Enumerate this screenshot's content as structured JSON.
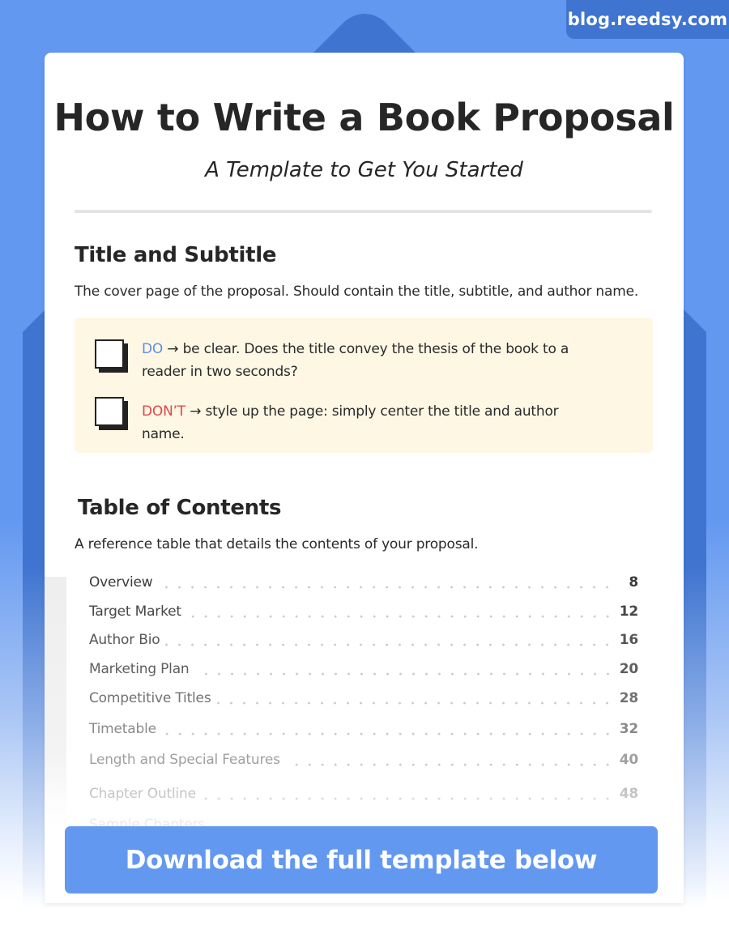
{
  "site_badge": "blog.reedsy.com",
  "colors": {
    "background_blue": "#6298f0",
    "dark_blue": "#3f74d0",
    "do_color": "#5b8fe6",
    "dont_color": "#e0454a",
    "tip_background": "#fdf7e4",
    "cta_background": "#6298f0"
  },
  "document": {
    "title": "How to Write a Book Proposal",
    "subtitle": "A Template to Get You Started"
  },
  "sections": [
    {
      "heading": "Title and Subtitle",
      "description": "The cover page of the proposal. Should contain the title, subtitle, and author name.",
      "tips": [
        {
          "keyword": "DO",
          "arrow": "→",
          "text": "be clear. Does the title convey the thesis of the book to a reader in two seconds?"
        },
        {
          "keyword": "DON’T",
          "arrow": "→",
          "text": "style up the page: simply center the title and author name."
        }
      ]
    },
    {
      "heading": "Table of Contents",
      "description": "A reference table that details the contents of your proposal.",
      "toc": [
        {
          "label": "Overview",
          "page": "8"
        },
        {
          "label": "Target Market",
          "page": "12"
        },
        {
          "label": "Author Bio",
          "page": "16"
        },
        {
          "label": "Marketing Plan",
          "page": "20"
        },
        {
          "label": "Competitive Titles",
          "page": "28"
        },
        {
          "label": "Timetable",
          "page": "32"
        },
        {
          "label": "Length and Special Features",
          "page": "40"
        },
        {
          "label": "Chapter Outline",
          "page": "48"
        },
        {
          "label": "Sample Chapters",
          "page": ""
        }
      ]
    }
  ],
  "cta": {
    "label": "Download the full template below"
  }
}
